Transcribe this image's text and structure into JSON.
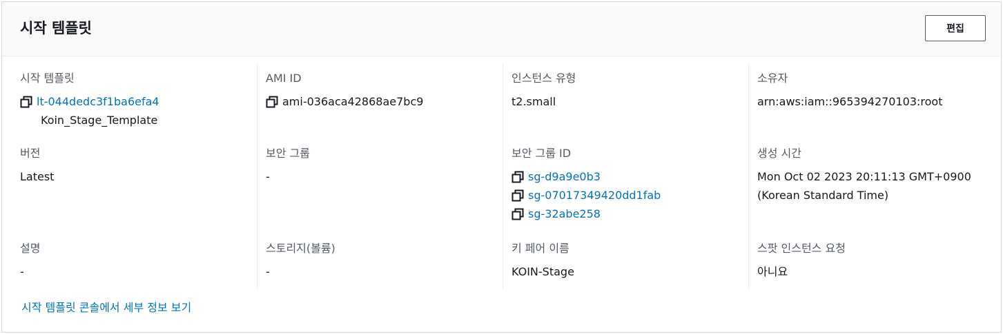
{
  "panel": {
    "title": "시작 템플릿",
    "edit_label": "편집"
  },
  "fields": {
    "launch_template_label": "시작 템플릿",
    "launch_template_id": "lt-044dedc3f1ba6efa4",
    "launch_template_name": "Koin_Stage_Template",
    "ami_label": "AMI ID",
    "ami_value": "ami-036aca42868ae7bc9",
    "instance_type_label": "인스턴스 유형",
    "instance_type_value": "t2.small",
    "owner_label": "소유자",
    "owner_value": "arn:aws:iam::965394270103:root",
    "version_label": "버전",
    "version_value": "Latest",
    "security_groups_label": "보안 그룹",
    "security_groups_value": "-",
    "security_group_ids_label": "보안 그룹 ID",
    "security_group_ids": [
      "sg-d9a9e0b3",
      "sg-07017349420dd1fab",
      "sg-32abe258"
    ],
    "created_label": "생성 시간",
    "created_line1": "Mon Oct 02 2023 20:11:13 GMT+0900",
    "created_line2": "(Korean Standard Time)",
    "description_label": "설명",
    "description_value": "-",
    "storage_label": "스토리지(볼륨)",
    "storage_value": "-",
    "key_pair_label": "키 페어 이름",
    "key_pair_value": "KOIN-Stage",
    "spot_label": "스팟 인스턴스 요청",
    "spot_value": "아니요"
  },
  "footer": {
    "link_label": "시작 템플릿 콘솔에서 세부 정보 보기"
  },
  "icons": {
    "copy": "copy-icon"
  },
  "colors": {
    "link": "#0073bb",
    "label": "#545b64",
    "text": "#16191f"
  }
}
